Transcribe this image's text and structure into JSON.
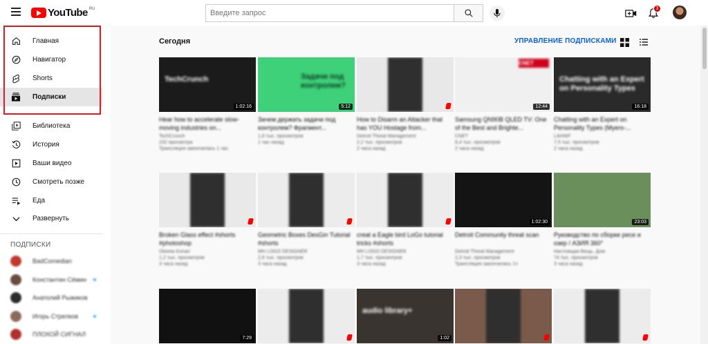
{
  "header": {
    "logo_text": "YouTube",
    "logo_region": "RU",
    "search_placeholder": "Введите запрос",
    "notification_count": "3"
  },
  "sidebar": {
    "main_items": [
      {
        "label": "Главная",
        "icon": "home-icon"
      },
      {
        "label": "Навигатор",
        "icon": "compass-icon"
      },
      {
        "label": "Shorts",
        "icon": "shorts-icon"
      },
      {
        "label": "Подписки",
        "icon": "subscriptions-icon",
        "active": true
      }
    ],
    "library_items": [
      {
        "label": "Библиотека",
        "icon": "library-icon"
      },
      {
        "label": "История",
        "icon": "history-icon"
      },
      {
        "label": "Ваши видео",
        "icon": "your-videos-icon"
      },
      {
        "label": "Смотреть позже",
        "icon": "watch-later-icon"
      },
      {
        "label": "Еда",
        "icon": "playlist-icon"
      },
      {
        "label": "Развернуть",
        "icon": "chevron-down-icon"
      }
    ],
    "subscriptions_title": "ПОДПИСКИ",
    "subscriptions": [
      {
        "name": "BadComedian",
        "color": "#c0392b",
        "new": false
      },
      {
        "name": "Константин Сёмин",
        "color": "#6b4b3e",
        "new": true
      },
      {
        "name": "Анатолий Рыжиков",
        "color": "#2c2c2c",
        "new": false
      },
      {
        "name": "Игорь Стрелков",
        "color": "#8a6a5a",
        "new": true
      },
      {
        "name": "ПЛОХОЙ СИГНАЛ",
        "color": "#b03030",
        "new": false
      }
    ]
  },
  "main": {
    "section_title": "Сегодня",
    "manage_label": "УПРАВЛЕНИЕ ПОДПИСКАМИ",
    "videos": [
      {
        "title": "Hear how to accelerate slow-moving industries on...",
        "channel": "TechCrunch",
        "views": "232 просмотра",
        "extra": "Трансляция закончилась 1 час",
        "duration": "1:02:16",
        "thumb_bg": "#1b1b1b",
        "thumb_text": "TechCrunch",
        "short": false
      },
      {
        "title": "Зачем держать задачи под контролем? Фрагмент...",
        "channel": "",
        "views": "1,8 тыс. просмотров",
        "extra": "1 час назад",
        "duration": "5:12",
        "thumb_bg": "#3fd07a",
        "thumb_text": "Задачи под контролем?",
        "short": false
      },
      {
        "title": "How to Disarm an Attacker that has YOU Hostage from...",
        "channel": "Detroit Threat Management",
        "views": "2,2 тыс. просмотров",
        "extra": "2 часа назад",
        "duration": "",
        "thumb_bg": "#e8e8e8",
        "thumb_text": "",
        "short": true
      },
      {
        "title": "Samsung QN90B QLED TV: One of the Best and Brighte...",
        "channel": "CNET",
        "views": "8,4 тыс. просмотров",
        "extra": "2 часа назад",
        "duration": "12:44",
        "thumb_bg": "#f0f0f0",
        "thumb_text": "CNET",
        "short": false
      },
      {
        "title": "Chatting with an Expert on Personality Types (Myers-...",
        "channel": "LAHWF",
        "views": "7,5 тыс. просмотров",
        "extra": "2 часа назад",
        "duration": "16:18",
        "thumb_bg": "#2a2a2a",
        "thumb_text": "Chatting with an Expert on Personality Types",
        "short": false
      },
      {
        "title": "Broken Glass effect #shorts #photoshop",
        "channel": "Okeeta Konari",
        "views": "1,2 тыс. просмотров",
        "extra": "3 часа назад",
        "duration": "",
        "thumb_bg": "#e9e9e9",
        "thumb_text": "",
        "short": true
      },
      {
        "title": "Geometric Boxes DesGin Tutorial #shorts",
        "channel": "MH LOGO DESIGNER",
        "views": "2,6 тыс. просмотров",
        "extra": "3 часа назад",
        "duration": "",
        "thumb_bg": "#ececec",
        "thumb_text": "",
        "short": true
      },
      {
        "title": "creat a Eagle bird LoGo tutorial tricks #shorts",
        "channel": "MH LOGO DESIGNER",
        "views": "1,7 тыс. просмотров",
        "extra": "3 часа назад",
        "duration": "",
        "thumb_bg": "#ececec",
        "thumb_text": "",
        "short": true
      },
      {
        "title": "Detroit Community threat scan",
        "channel": "Detroit Threat Management",
        "views": "2,3 тыс. просмотров",
        "extra": "Трансляция закончилась 1ч",
        "duration": "1:02:30",
        "thumb_bg": "#141414",
        "thumb_text": "",
        "short": false
      },
      {
        "title": "Руководство по сборке ресе и озер / A3ИЯ 360°",
        "channel": "Настоящая Вещь. Дом",
        "views": "74 тыс. просмотров",
        "extra": "3 часа назад",
        "duration": "23:03",
        "thumb_bg": "#6a8f5a",
        "thumb_text": "",
        "short": false
      },
      {
        "title": "",
        "channel": "",
        "views": "",
        "extra": "",
        "duration": "7:29",
        "thumb_bg": "#111111",
        "thumb_text": "",
        "short": false
      },
      {
        "title": "",
        "channel": "",
        "views": "",
        "extra": "",
        "duration": "",
        "thumb_bg": "#ececec",
        "thumb_text": "",
        "short": true
      },
      {
        "title": "",
        "channel": "",
        "views": "",
        "extra": "",
        "duration": "1:02",
        "thumb_bg": "#3a3430",
        "thumb_text": "audio library+",
        "short": false
      },
      {
        "title": "",
        "channel": "",
        "views": "",
        "extra": "",
        "duration": "",
        "thumb_bg": "#7a5a4a",
        "thumb_text": "",
        "short": true
      },
      {
        "title": "",
        "channel": "",
        "views": "",
        "extra": "",
        "duration": "",
        "thumb_bg": "#ececec",
        "thumb_text": "",
        "short": true
      }
    ]
  },
  "colors": {
    "accent": "#065fd4",
    "brand_red": "#ff0000",
    "highlight_box": "#e0161e"
  }
}
